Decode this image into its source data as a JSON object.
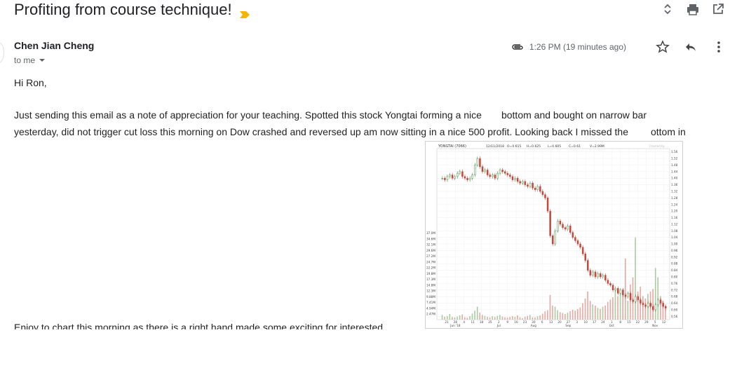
{
  "email": {
    "subject": "Profiting from course technique!",
    "sender": "Chen Jian Cheng",
    "to_label": "to me",
    "time": "1:26 PM (19 minutes ago)",
    "greeting": "Hi Ron,",
    "body_line1a": "Just sending this email as a note of appreciation for your teaching. Spotted this stock Yongtai forming a nice",
    "body_line1b": "bottom and bought on narrow bar",
    "body_line2a": "yesterday, did not trigger cut loss this morning on Dow crashed and reversed up am now sitting in a nice 500 profit. Looking back I missed the",
    "body_line2b": "ottom in",
    "cut_line": "Enjoy to chart this morning as there is a right hand made some exciting for interested"
  },
  "icons": {
    "important": "importance-marker-icon",
    "expand": "expand-collapse-icon",
    "print": "print-icon",
    "open": "open-in-new-window-icon",
    "attachment": "paperclip-icon",
    "star": "star-icon",
    "reply": "reply-icon",
    "more": "more-vertical-icon"
  },
  "colors": {
    "important": "#f4b400",
    "up_candle": "#4a8f4a",
    "down_candle": "#c4473a",
    "volume_up": "#a8cca0",
    "volume_down": "#e8a7a0"
  },
  "chart_data": {
    "type": "candlestick",
    "title": "YONGTAI (7066)",
    "header": {
      "date": "12/11/2018",
      "open": "O=0.615",
      "high": "H=0.625",
      "low": "L=0.605",
      "close": "C=0.61",
      "volume": "V=2.99M"
    },
    "watermark": "Charted by ...",
    "price_ticks": [
      "1.56",
      "1.52",
      "1.48",
      "1.44",
      "1.40",
      "1.36",
      "1.32",
      "1.28",
      "1.24",
      "1.20",
      "1.16",
      "1.12",
      "1.08",
      "1.04",
      "1.00",
      "0.96",
      "0.92",
      "0.88",
      "0.84",
      "0.80",
      "0.76",
      "0.72",
      "0.68",
      "0.64",
      "0.60",
      "0.56"
    ],
    "volume_ticks": [
      "37.0M",
      "34.6M",
      "32.1M",
      "29.6M",
      "27.2M",
      "24.7M",
      "22.2M",
      "19.8M",
      "17.3M",
      "14.8M",
      "12.3M",
      "9.88M",
      "7.41M",
      "4.94M",
      "2.47M"
    ],
    "ylim": [
      0.54,
      1.58
    ],
    "volume_max": 37.0,
    "x_day_ticks": [
      "21",
      "28",
      "4",
      "11",
      "18",
      "25",
      "2",
      "9",
      "16",
      "23",
      "30",
      "6",
      "13",
      "20",
      "27",
      "3",
      "10",
      "17",
      "24",
      "1",
      "8",
      "15",
      "22",
      "29",
      "5",
      "12"
    ],
    "x_month_ticks": [
      {
        "label": "Jun '18",
        "at": 1
      },
      {
        "label": "Jul",
        "at": 6
      },
      {
        "label": "Aug",
        "at": 10
      },
      {
        "label": "Sep",
        "at": 14
      },
      {
        "label": "Oct",
        "at": 19
      },
      {
        "label": "Nov",
        "at": 24
      }
    ],
    "close": [
      1.4,
      1.39,
      1.41,
      1.42,
      1.4,
      1.41,
      1.43,
      1.44,
      1.41,
      1.4,
      1.39,
      1.4,
      1.42,
      1.48,
      1.52,
      1.47,
      1.44,
      1.45,
      1.42,
      1.41,
      1.42,
      1.4,
      1.43,
      1.45,
      1.44,
      1.43,
      1.42,
      1.41,
      1.39,
      1.4,
      1.38,
      1.37,
      1.38,
      1.36,
      1.35,
      1.37,
      1.34,
      1.33,
      1.35,
      1.32,
      1.3,
      1.28,
      1.2,
      1.05,
      1.0,
      1.08,
      1.14,
      1.12,
      1.1,
      1.09,
      1.11,
      1.07,
      1.04,
      1.02,
      1.0,
      0.98,
      0.94,
      0.9,
      0.84,
      0.81,
      0.83,
      0.8,
      0.82,
      0.8,
      0.81,
      0.78,
      0.76,
      0.75,
      0.72,
      0.73,
      0.7,
      0.72,
      0.69,
      0.68,
      0.7,
      0.66,
      0.65,
      0.68,
      0.66,
      0.64,
      0.63,
      0.62,
      0.64,
      0.62,
      0.6,
      0.63,
      0.66,
      0.64,
      0.62,
      0.61
    ],
    "volume": [
      2.0,
      1.2,
      1.5,
      2.4,
      1.1,
      0.9,
      1.3,
      1.8,
      2.2,
      1.0,
      0.8,
      1.5,
      2.6,
      3.8,
      5.5,
      3.0,
      2.0,
      1.6,
      1.2,
      1.0,
      1.4,
      1.1,
      1.6,
      2.0,
      1.3,
      1.0,
      0.9,
      1.1,
      1.5,
      1.2,
      1.8,
      1.0,
      0.7,
      1.2,
      1.6,
      2.0,
      1.0,
      0.9,
      1.4,
      1.8,
      2.5,
      3.5,
      4.0,
      10.5,
      6.0,
      5.5,
      4.0,
      3.2,
      2.8,
      2.4,
      3.0,
      3.6,
      4.2,
      3.8,
      4.5,
      5.2,
      7.0,
      9.0,
      12.0,
      8.0,
      6.5,
      6.0,
      5.0,
      4.5,
      5.5,
      6.0,
      7.5,
      8.5,
      9.5,
      12.5,
      10.0,
      11.0,
      13.0,
      26.0,
      8.0,
      15.0,
      18.0,
      35.0,
      12.0,
      14.0,
      10.0,
      9.0,
      11.0,
      12.0,
      13.0,
      22.0,
      18.0,
      10.0,
      8.0,
      6.0
    ]
  }
}
